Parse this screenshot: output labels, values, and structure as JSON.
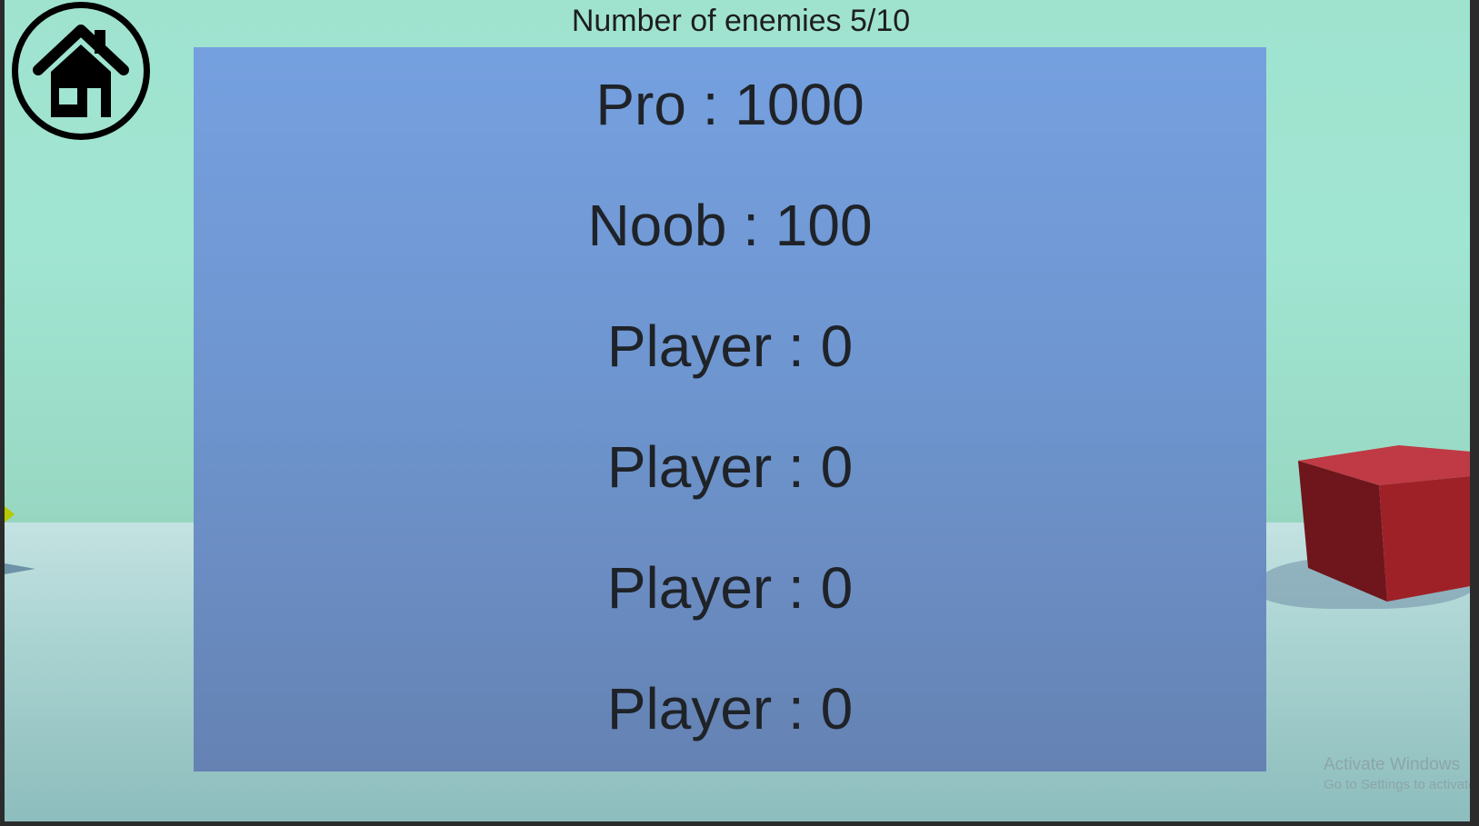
{
  "hud": {
    "enemy_counter": "Number of enemies 5/10",
    "home_icon": "home-icon"
  },
  "leaderboard": {
    "rows": [
      {
        "text": "Pro : 1000"
      },
      {
        "text": "Noob : 100"
      },
      {
        "text": "Player : 0"
      },
      {
        "text": "Player : 0"
      },
      {
        "text": "Player : 0"
      },
      {
        "text": "Player : 0"
      }
    ]
  },
  "scene": {
    "sky_color": "#a0e5d2",
    "ground_color": "#c4e2e2",
    "cube_color": "#b8343c",
    "panel_color": "#749ee0"
  },
  "watermark": {
    "title": "Activate Windows",
    "subtitle": "Go to Settings to activate W"
  }
}
